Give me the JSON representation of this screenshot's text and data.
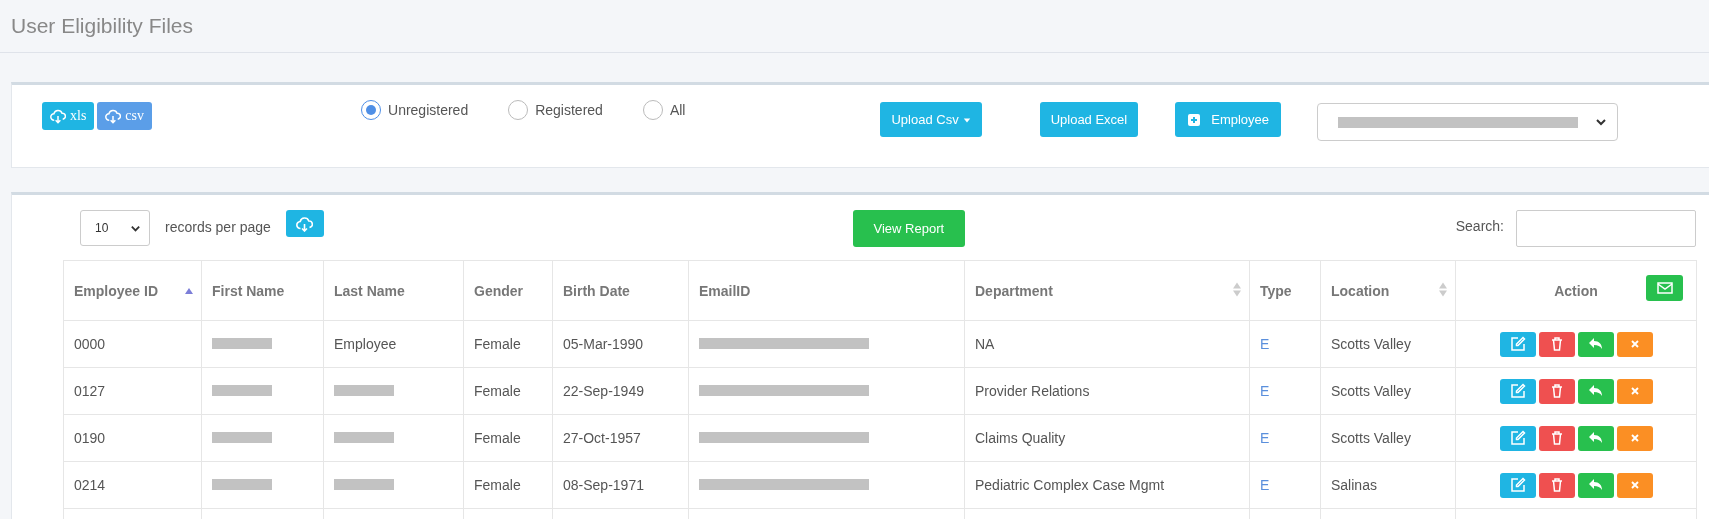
{
  "page_title": "User Eligibility Files",
  "export_buttons": [
    {
      "label": "xls",
      "kind": "xls"
    },
    {
      "label": "csv",
      "kind": "csv"
    }
  ],
  "filter_radios": [
    {
      "label": "Unregistered",
      "selected": true
    },
    {
      "label": "Registered",
      "selected": false
    },
    {
      "label": "All",
      "selected": false
    }
  ],
  "upload_csv": {
    "label": "Upload Csv"
  },
  "upload_excel": {
    "label": "Upload Excel"
  },
  "add_employee": {
    "label": "Employee"
  },
  "company_select": {
    "redacted": true
  },
  "page_size": {
    "value": "10",
    "label": "records per page"
  },
  "view_report": {
    "label": "View Report"
  },
  "search": {
    "label": "Search:"
  },
  "table": {
    "columns": [
      {
        "label": "Employee ID",
        "kind": "sorted"
      },
      {
        "label": "First Name",
        "kind": "plain"
      },
      {
        "label": "Last Name",
        "kind": "plain"
      },
      {
        "label": "Gender",
        "kind": "plain"
      },
      {
        "label": "Birth Date",
        "kind": "plain"
      },
      {
        "label": "EmailID",
        "kind": "plain"
      },
      {
        "label": "Department",
        "kind": "sortable"
      },
      {
        "label": "Type",
        "kind": "plain"
      },
      {
        "label": "Location",
        "kind": "sortable"
      },
      {
        "label": "Action",
        "kind": "plain"
      }
    ],
    "rows": [
      {
        "cells": [
          {
            "text": "0000"
          },
          {
            "redacted": true
          },
          {
            "text": "Employee"
          },
          {
            "text": "Female"
          },
          {
            "text": "05-Mar-1990"
          },
          {
            "redacted": true
          },
          {
            "text": "NA"
          },
          {
            "text": "E",
            "kind": "link"
          },
          {
            "text": "Scotts Valley"
          }
        ]
      },
      {
        "cells": [
          {
            "text": "0127"
          },
          {
            "redacted": true
          },
          {
            "redacted": true
          },
          {
            "text": "Female"
          },
          {
            "text": "22-Sep-1949"
          },
          {
            "redacted": true
          },
          {
            "text": "Provider Relations"
          },
          {
            "text": "E",
            "kind": "link"
          },
          {
            "text": "Scotts Valley"
          }
        ]
      },
      {
        "cells": [
          {
            "text": "0190"
          },
          {
            "redacted": true
          },
          {
            "redacted": true
          },
          {
            "text": "Female"
          },
          {
            "text": "27-Oct-1957"
          },
          {
            "redacted": true
          },
          {
            "text": "Claims Quality"
          },
          {
            "text": "E",
            "kind": "link"
          },
          {
            "text": "Scotts Valley"
          }
        ]
      },
      {
        "cells": [
          {
            "text": "0214"
          },
          {
            "redacted": true
          },
          {
            "redacted": true
          },
          {
            "text": "Female"
          },
          {
            "text": "08-Sep-1971"
          },
          {
            "redacted": true
          },
          {
            "text": "Pediatric Complex Case Mgmt"
          },
          {
            "text": "E",
            "kind": "link"
          },
          {
            "text": "Salinas"
          }
        ]
      }
    ]
  }
}
